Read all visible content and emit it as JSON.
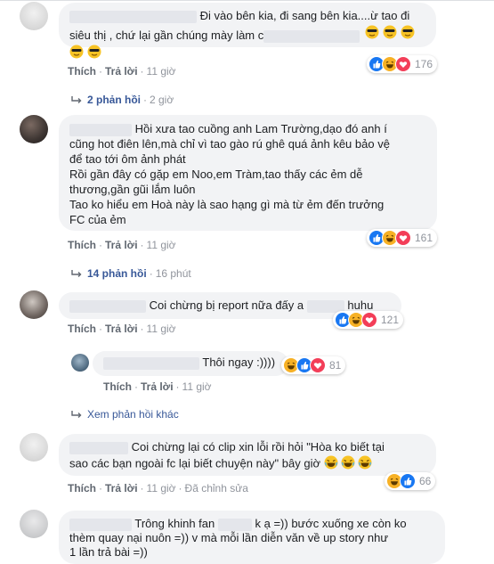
{
  "actions": {
    "like": "Thích",
    "reply": "Trả lời",
    "edited": "Đã chỉnh sửa",
    "separator": "·"
  },
  "colors": {
    "link": "#385898",
    "bubble": "#f2f3f5",
    "meta": "#90949c",
    "like_blue": "#1877f2",
    "haha_yellow": "#f7b125",
    "love_red": "#f33e58"
  },
  "comments": [
    {
      "lines": [
        "Đi vào bên kia, đi sang bên kia....ừ tao đi",
        "siêu thị , chứ lại gần chúng mày làm c"
      ],
      "time": "11 giờ",
      "reactions": [
        "like-icon",
        "haha-icon",
        "love-icon"
      ],
      "reaction_count": "176",
      "replies_label": "2 phản hồi",
      "replies_time": "2 giờ"
    },
    {
      "lines": [
        "Hồi xưa tao cuồng anh Lam Trường,dạo đó anh í",
        "cũng hot điên lên,mà chỉ vì tao gào rú ghê quá ảnh kêu bảo vệ",
        "để tao tới ôm ảnh phát",
        "Rồi gần đây có gặp em Noo,em Tràm,tao thấy các ẻm dễ",
        "thương,gần gũi lắm luôn",
        "Tao ko hiểu em Hoà này là sao hạng gì mà từ ẻm đến trưởng",
        "FC của ẻm"
      ],
      "time": "11 giờ",
      "reactions": [
        "like-icon",
        "haha-icon",
        "love-icon"
      ],
      "reaction_count": "161",
      "replies_label": "14 phản hồi",
      "replies_time": "16 phút"
    },
    {
      "text_pre": "Coi chừng bị report nữa đấy a",
      "text_post": "huhu",
      "time": "11 giờ",
      "reactions": [
        "like-icon",
        "haha-icon",
        "love-icon"
      ],
      "reaction_count": "121"
    },
    {
      "text": "Coi chừng lại có clip xin lỗi rồi hỏi \"Hòa ko biết tại",
      "text2": "sao các bạn ngoài fc lại biết chuyện này\" bây giờ",
      "time": "11 giờ",
      "edited": "Đã chỉnh sửa",
      "reactions": [
        "haha-icon",
        "like-icon"
      ],
      "reaction_count": "66"
    },
    {
      "lines_pre": "Trông khinh fan",
      "lines_mid": "k ạ =)) bước xuống xe còn ko",
      "line2": "thèm quay nại nuôn =)) v mà mỗi lần diễn văn về up story như",
      "line3": "1 lần trả bài =))"
    }
  ],
  "reply": {
    "text": "Thôi ngay :))))",
    "time": "11 giờ",
    "reactions": [
      "haha-icon",
      "like-icon",
      "love-icon"
    ],
    "reaction_count": "81"
  },
  "more_replies": "Xem phản hồi khác"
}
